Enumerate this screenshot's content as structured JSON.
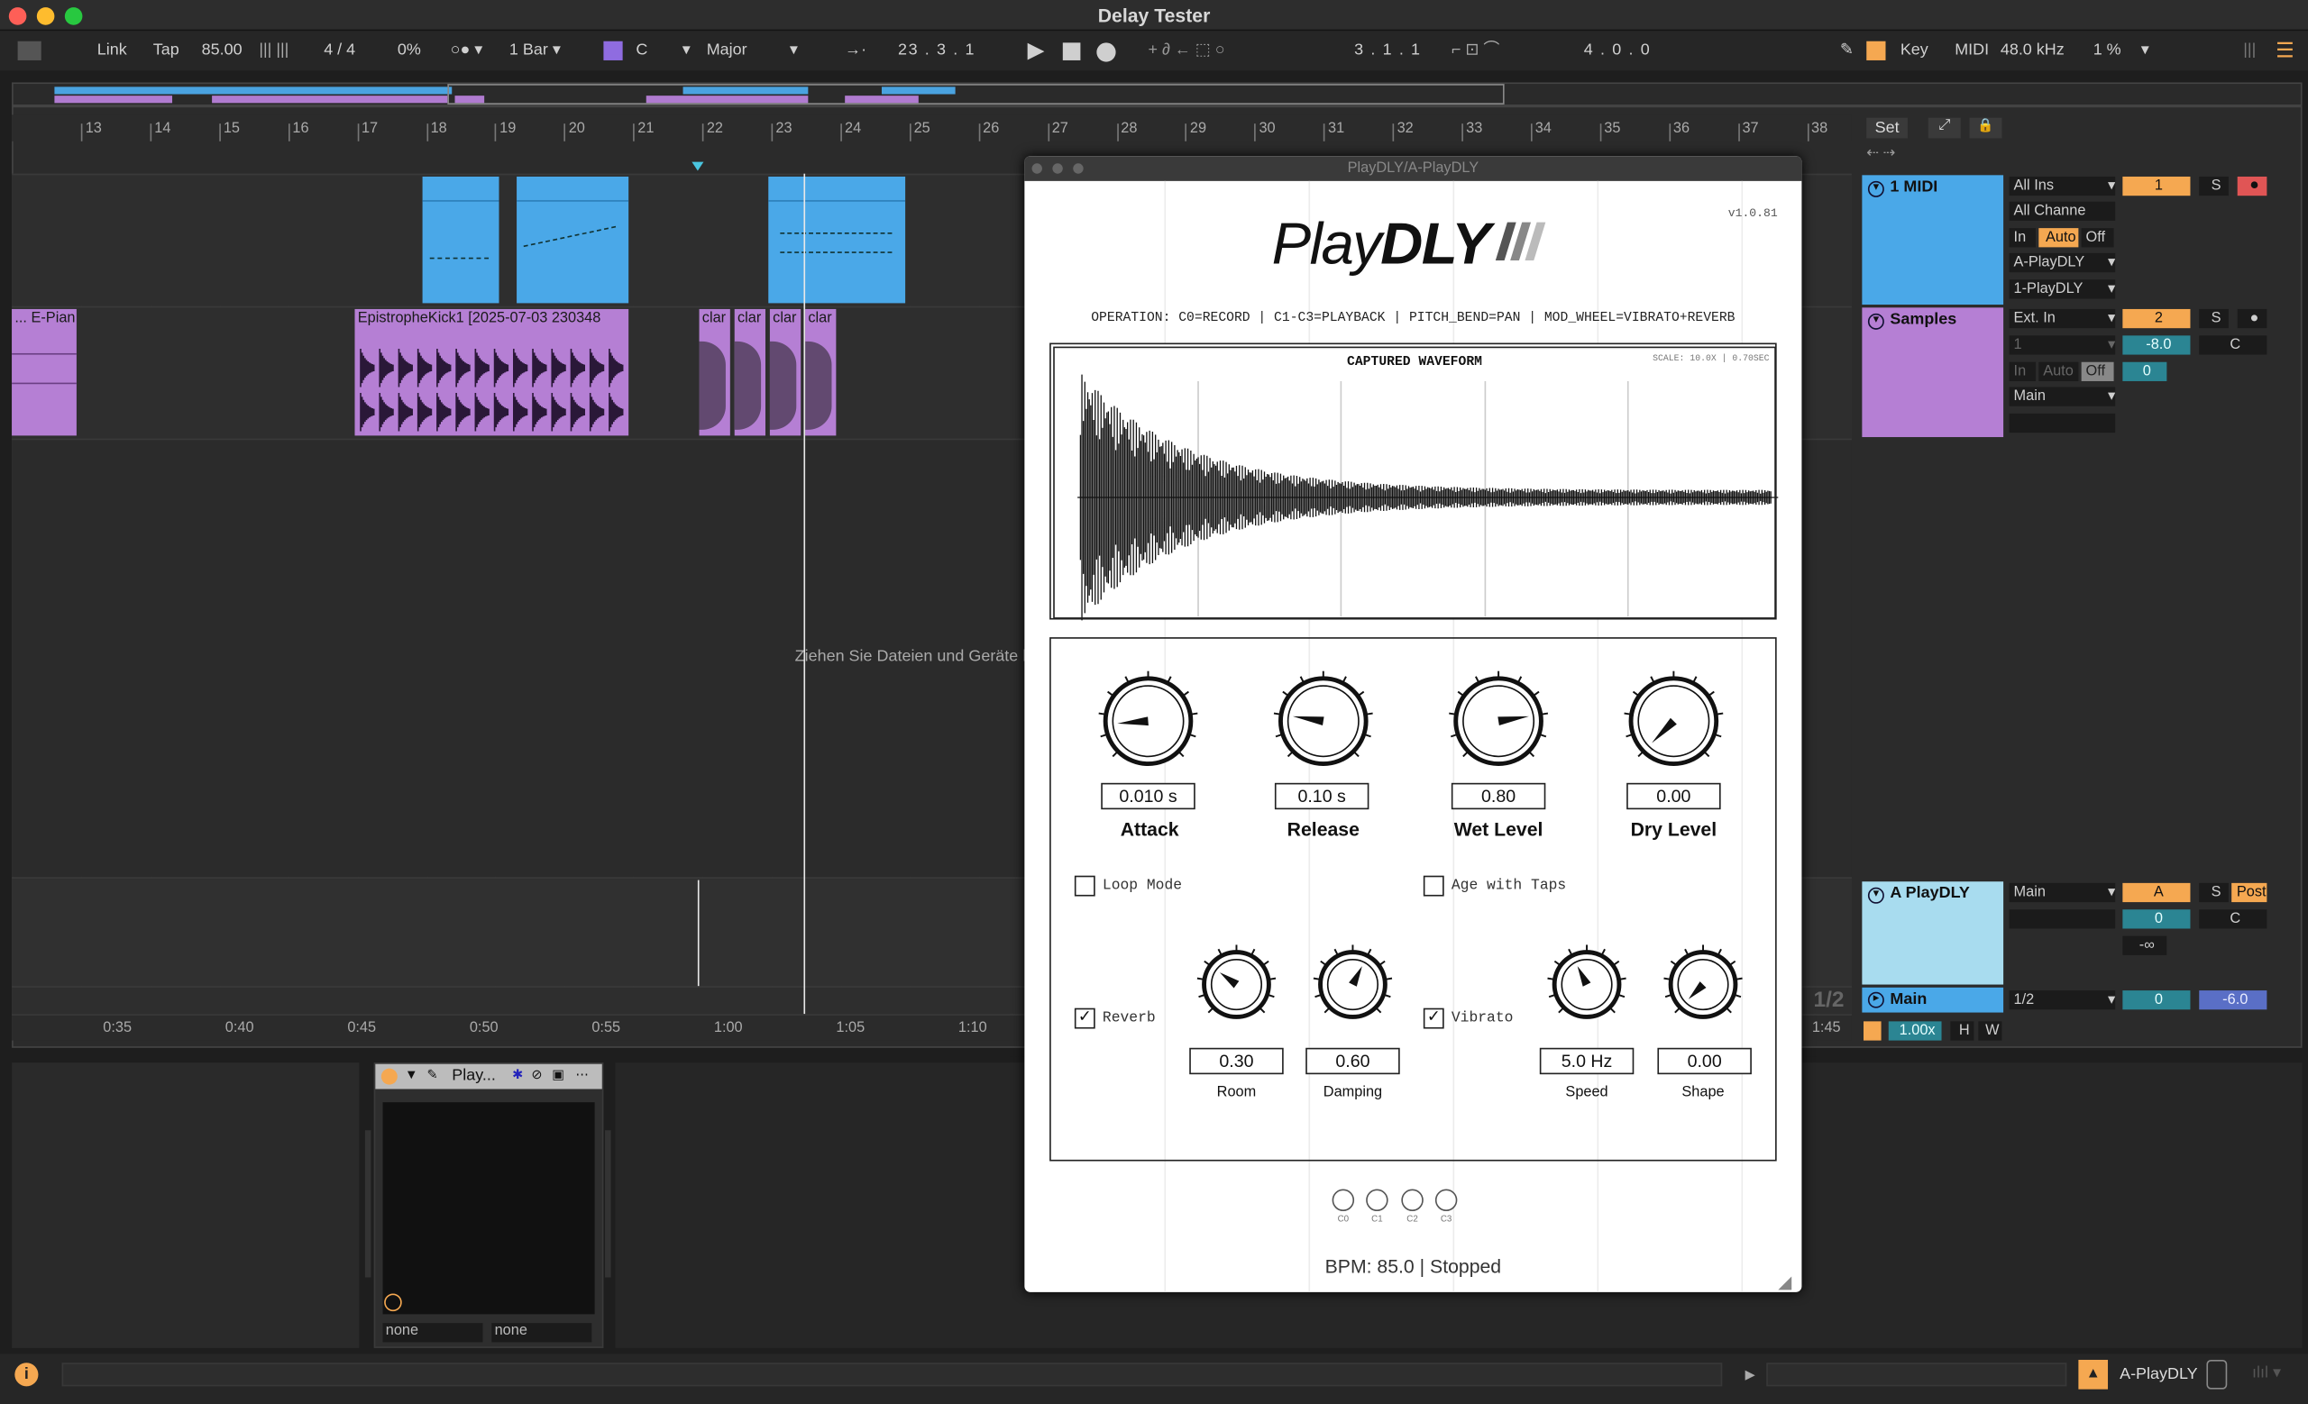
{
  "window": {
    "title": "Delay Tester"
  },
  "control_bar": {
    "link": "Link",
    "tap": "Tap",
    "tempo": "85.00",
    "time_sig": "4 / 4",
    "groove": "0%",
    "quantize": "1 Bar",
    "key_root": "C",
    "scale": "Major",
    "position": "23 .  3 .  1",
    "loop_start": "3 .  1 .  1",
    "loop_length": "4 .  0 .  0",
    "key": "Key",
    "midi": "MIDI",
    "sample_rate": "48.0 kHz",
    "cpu": "1 %"
  },
  "ruler": {
    "bars": [
      "13",
      "14",
      "15",
      "16",
      "17",
      "18",
      "19",
      "20",
      "21",
      "22",
      "23",
      "24",
      "25",
      "26",
      "27",
      "28",
      "29",
      "30",
      "31",
      "32",
      "33",
      "34",
      "35",
      "36",
      "37",
      "38"
    ]
  },
  "time_ruler": {
    "marks": [
      "0:35",
      "0:40",
      "0:45",
      "0:50",
      "0:55",
      "1:00",
      "1:05",
      "1:10",
      "1:45"
    ]
  },
  "clips": {
    "epiano": "... E-Pian",
    "kick": "EpistropheKick1 [2025-07-03 230348",
    "clap1": "clar",
    "clap2": "clar",
    "clap3": "clar",
    "clap4": "clar"
  },
  "drop_hint": "Ziehen Sie Dateien und Geräte h",
  "set_button": "Set",
  "tracks": [
    {
      "name": "1 MIDI",
      "input": "All Ins",
      "channel": "All Channe",
      "in": "In",
      "auto": "Auto",
      "off": "Off",
      "out1": "A-PlayDLY",
      "out2": "1-PlayDLY",
      "number": "1",
      "solo": "S"
    },
    {
      "name": "Samples",
      "input": "Ext. In",
      "channel": "1",
      "in": "In",
      "auto": "Auto",
      "off": "Off",
      "output": "Main",
      "number": "2",
      "solo": "S",
      "volume": "-8.0",
      "pan": "C",
      "send": "0"
    },
    {
      "name": "A PlayDLY",
      "output": "Main",
      "letter": "A",
      "solo": "S",
      "post": "Post",
      "send": "0",
      "pan": "C",
      "inf": "-∞"
    },
    {
      "name": "Main",
      "output": "1/2",
      "send": "0",
      "volume": "-6.0",
      "fraction": "1/2",
      "zoom": "1.00x",
      "h": "H",
      "w": "W"
    }
  ],
  "device": {
    "title": "Play...",
    "in1": "none",
    "in2": "none"
  },
  "status": {
    "device_name": "A-PlayDLY"
  },
  "plugin": {
    "window_title": "PlayDLY/A-PlayDLY",
    "version": "v1.0.81",
    "logo_play": "Play",
    "logo_dly": "DLY",
    "operation": "OPERATION: C0=RECORD | C1-C3=PLAYBACK | PITCH_BEND=PAN | MOD_WHEEL=VIBRATO+REVERB",
    "waveform_title": "CAPTURED WAVEFORM",
    "waveform_scale": "SCALE: 10.0X | 0.70SEC",
    "knobs": [
      {
        "label": "Attack",
        "value": "0.010 s",
        "level": 0.15
      },
      {
        "label": "Release",
        "value": "0.10 s",
        "level": 0.2
      },
      {
        "label": "Wet Level",
        "value": "0.80",
        "level": 0.8
      },
      {
        "label": "Dry Level",
        "value": "0.00",
        "level": 0.0
      }
    ],
    "loop_mode": "Loop Mode",
    "age_with_taps": "Age with Taps",
    "reverb": "Reverb",
    "vibrato": "Vibrato",
    "small_knobs": [
      {
        "label": "Room",
        "value": "0.30",
        "level": 0.3
      },
      {
        "label": "Damping",
        "value": "0.60",
        "level": 0.6
      },
      {
        "label": "Speed",
        "value": "5.0 Hz",
        "level": 0.4
      },
      {
        "label": "Shape",
        "value": "0.00",
        "level": 0.0
      }
    ],
    "midi_notes": [
      "C0",
      "C1",
      "C2",
      "C3"
    ],
    "status_line": "BPM: 85.0 | Stopped"
  }
}
